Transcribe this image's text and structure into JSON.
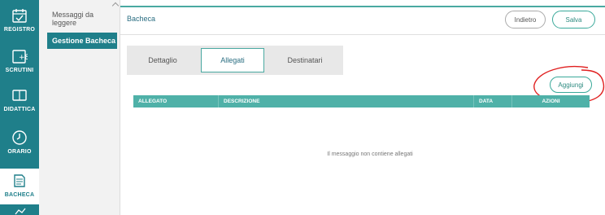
{
  "nav_rail": {
    "items": [
      {
        "label": "REGISTRO",
        "icon": "calendar-check-icon"
      },
      {
        "label": "SCRUTINI",
        "icon": "grade-icon"
      },
      {
        "label": "DIDATTICA",
        "icon": "book-open-icon"
      },
      {
        "label": "ORARIO",
        "icon": "clock-icon"
      },
      {
        "label": "BACHECA",
        "icon": "board-icon"
      }
    ]
  },
  "subnav": {
    "items": [
      {
        "label": "Messaggi da leggere"
      },
      {
        "label": "Gestione Bacheca"
      }
    ]
  },
  "header": {
    "title": "Bacheca",
    "back_label": "Indietro",
    "save_label": "Salva"
  },
  "tabs": [
    {
      "label": "Dettaglio"
    },
    {
      "label": "Allegati"
    },
    {
      "label": "Destinatari"
    }
  ],
  "attachments": {
    "add_label": "Aggiungi",
    "columns": [
      "ALLEGATO",
      "DESCRIZIONE",
      "DATA",
      "AZIONI"
    ],
    "empty_message": "Il messaggio non contiene allegati"
  },
  "colors": {
    "accent": "#1f7f8a",
    "table_header": "#4fb1a8",
    "annotation": "#e02020"
  }
}
